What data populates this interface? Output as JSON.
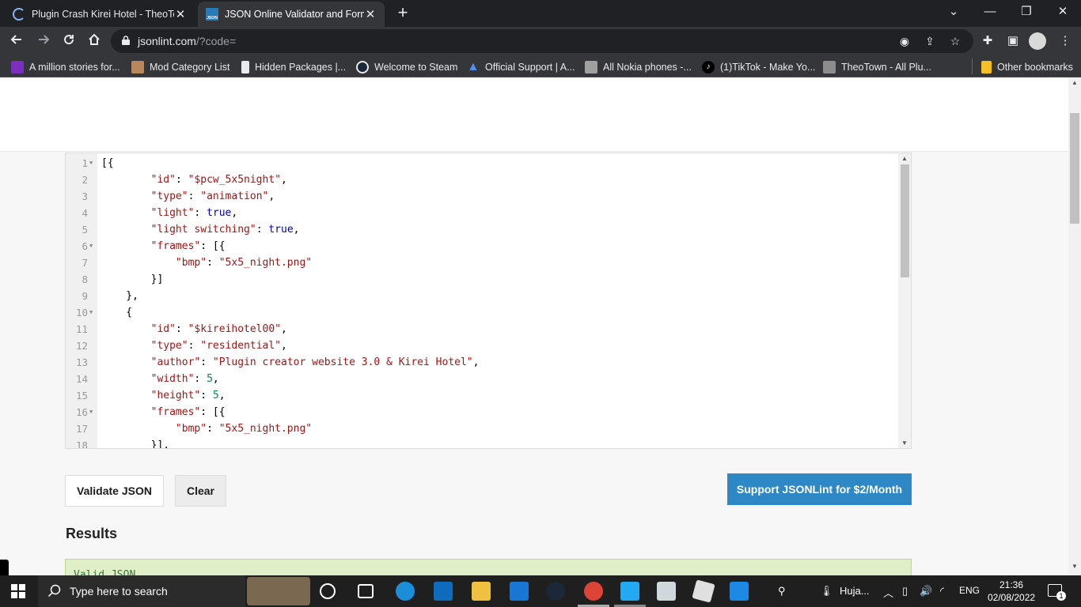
{
  "browser": {
    "tabs": [
      {
        "title": "Plugin Crash Kirei Hotel - TheoTo",
        "icon": "loading-spinner-icon",
        "close": "✕"
      },
      {
        "title": "JSON Online Validator and Forma",
        "icon": "jsonlint-favicon-icon",
        "favicon_text": "JSON",
        "close": "✕"
      }
    ],
    "new_tab": "+",
    "window_controls": {
      "minimize": "—",
      "restore": "❐",
      "close": "✕",
      "dropdown": "⌄"
    },
    "url": {
      "host": "jsonlint.com",
      "path": "/?code="
    },
    "bookmarks": [
      {
        "label": "A million stories for...",
        "color": "#7b2fbe"
      },
      {
        "label": "Mod Category List",
        "color": "#b8875a"
      },
      {
        "label": "Hidden Packages |...",
        "color": "#e8eaed"
      },
      {
        "label": "Welcome to Steam",
        "color": "#1b2838"
      },
      {
        "label": "Official Support | A...",
        "color": "#1e6fd9"
      },
      {
        "label": "All Nokia phones -...",
        "color": "#a0a0a0"
      },
      {
        "label": "(1)TikTok - Make Yo...",
        "color": "#000000"
      },
      {
        "label": "TheoTown - All Plu...",
        "color": "#8c8c8c"
      },
      {
        "label": "Other bookmarks",
        "color": "#f6c026"
      }
    ]
  },
  "editor": {
    "lines": [
      {
        "n": "1",
        "fold": true,
        "code": "[{"
      },
      {
        "n": "2",
        "fold": false,
        "code": "        \"id\": \"$pcw_5x5night\","
      },
      {
        "n": "3",
        "fold": false,
        "code": "        \"type\": \"animation\","
      },
      {
        "n": "4",
        "fold": false,
        "code": "        \"light\": true,"
      },
      {
        "n": "5",
        "fold": false,
        "code": "        \"light switching\": true,"
      },
      {
        "n": "6",
        "fold": true,
        "code": "        \"frames\": [{"
      },
      {
        "n": "7",
        "fold": false,
        "code": "            \"bmp\": \"5x5_night.png\""
      },
      {
        "n": "8",
        "fold": false,
        "code": "        }]"
      },
      {
        "n": "9",
        "fold": false,
        "code": "    },"
      },
      {
        "n": "10",
        "fold": true,
        "code": "    {"
      },
      {
        "n": "11",
        "fold": false,
        "code": "        \"id\": \"$kireihotel00\","
      },
      {
        "n": "12",
        "fold": false,
        "code": "        \"type\": \"residential\","
      },
      {
        "n": "13",
        "fold": false,
        "code": "        \"author\": \"Plugin creator website 3.0 & Kirei Hotel\","
      },
      {
        "n": "14",
        "fold": false,
        "code": "        \"width\": 5,"
      },
      {
        "n": "15",
        "fold": false,
        "code": "        \"height\": 5,"
      },
      {
        "n": "16",
        "fold": true,
        "code": "        \"frames\": [{"
      },
      {
        "n": "17",
        "fold": false,
        "code": "            \"bmp\": \"5x5_night.png\""
      },
      {
        "n": "18",
        "fold": false,
        "code": "        }],"
      }
    ]
  },
  "buttons": {
    "validate": "Validate JSON",
    "clear": "Clear",
    "support": "Support JSONLint for $2/Month"
  },
  "results": {
    "heading": "Results",
    "text": "Valid JSON"
  },
  "taskbar": {
    "search_placeholder": "Type here to search",
    "weather": "Huja...",
    "language": "ENG",
    "time": "21:36",
    "date": "02/08/2022",
    "notification_count": "1"
  },
  "colors": {
    "support_button": "#2d88c5",
    "result_background": "#dff0c8",
    "string": "#a31515",
    "boolean": "#0000aa",
    "number": "#098658"
  }
}
